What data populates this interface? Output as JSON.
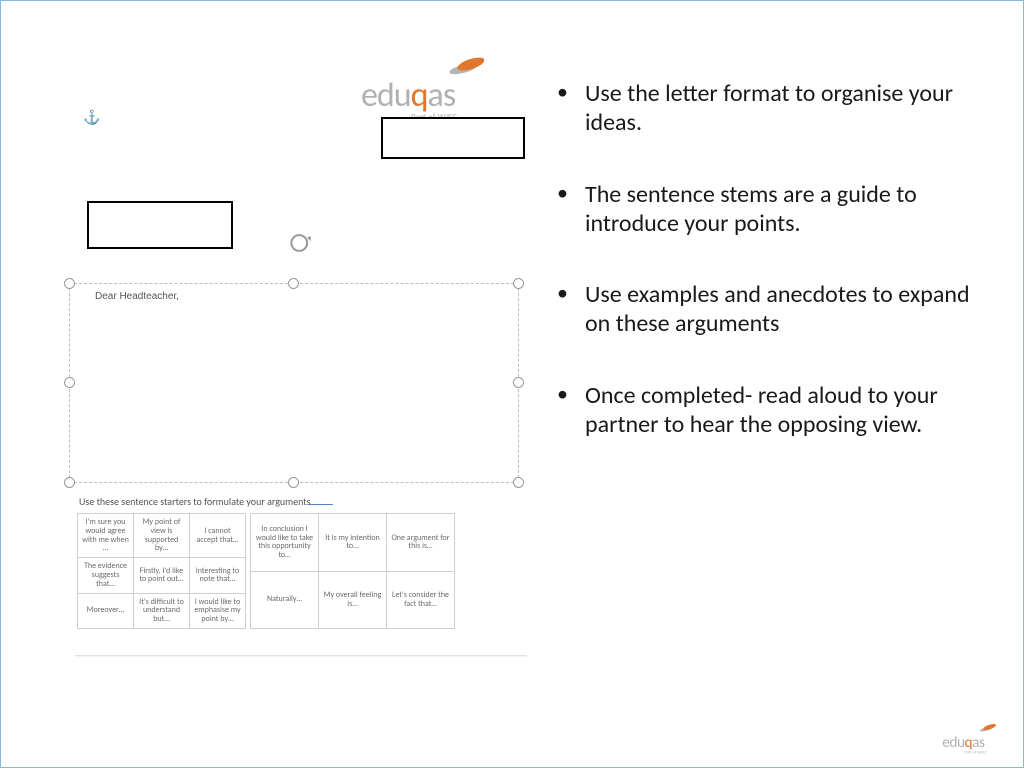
{
  "logo": {
    "text_pre": "edu",
    "text_q": "q",
    "text_post": "as",
    "sub": "Part of WJEC"
  },
  "worksheet": {
    "dear": "Dear Headteacher,",
    "starters_intro": "Use these sentence starters to formulate your arguments",
    "table1": [
      [
        "I'm sure you would agree with me when …",
        "My point of view is supported by…",
        "I cannot accept that…"
      ],
      [
        "The evidence suggests that…",
        "Firstly, I'd like to point out…",
        "Interesting to note that…"
      ],
      [
        "Moreover…",
        "It's difficult to understand but…",
        "I would like to emphasise my point by…"
      ]
    ],
    "table2": [
      [
        "In conclusion I would like to take this opportunity to…",
        "It is my intention to…",
        "One argument for this is…"
      ],
      [
        "Naturally…",
        "My overall feeling is…",
        "Let's consider the fact that…"
      ]
    ]
  },
  "bullets": [
    "Use the letter format to organise your ideas.",
    "The sentence stems are a guide to introduce your points.",
    "Use examples and anecdotes to expand on these arguments",
    "Once completed- read aloud to your partner to hear the opposing view."
  ]
}
